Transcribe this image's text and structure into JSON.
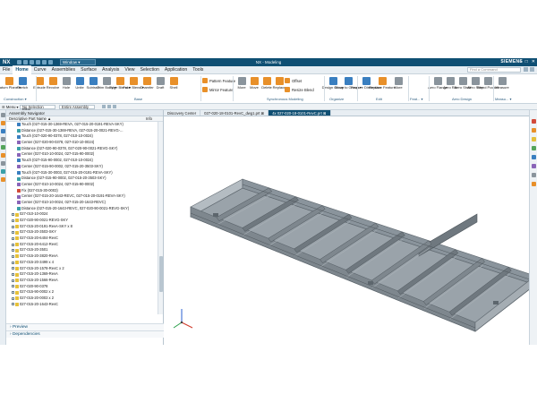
{
  "app": {
    "brand": "NX",
    "window_menu": "Window ▾",
    "window_title": "NX - Modeling",
    "company": "SIEMENS",
    "command_finder_placeholder": "Find a Command"
  },
  "menu": [
    "File",
    "Home",
    "Curve",
    "Assemblies",
    "Surface",
    "Analysis",
    "View",
    "Selection",
    "Application",
    "Tools"
  ],
  "menu_active_index": 1,
  "ribbon": {
    "buttons": [
      {
        "label": "Datum Plane ▾",
        "icon": "datum-plane-icon",
        "color": "c-orange"
      },
      {
        "label": "Sketch",
        "icon": "sketch-icon",
        "color": "c-blue"
      },
      {
        "label": "Extrude",
        "icon": "extrude-icon",
        "color": "c-orange"
      },
      {
        "label": "Revolve",
        "icon": "revolve-icon",
        "color": "c-orange"
      },
      {
        "label": "Hole",
        "icon": "hole-icon",
        "color": "c-gray"
      },
      {
        "label": "Unite",
        "icon": "unite-icon",
        "color": "c-blue"
      },
      {
        "label": "Subtract",
        "icon": "subtract-icon",
        "color": "c-blue"
      },
      {
        "label": "Trim Body ▾",
        "icon": "trim-body-icon",
        "color": "c-gray"
      },
      {
        "label": "Edge Blend ▾",
        "icon": "edge-blend-icon",
        "color": "c-orange"
      },
      {
        "label": "Face Blend ▾",
        "icon": "face-blend-icon",
        "color": "c-orange"
      },
      {
        "label": "Chamfer",
        "icon": "chamfer-icon",
        "color": "c-orange"
      },
      {
        "label": "Draft",
        "icon": "draft-icon",
        "color": "c-gray"
      },
      {
        "label": "Shell",
        "icon": "shell-icon",
        "color": "c-orange"
      }
    ],
    "small_buttons": [
      {
        "label": "Pattern Feature",
        "icon": "pattern-feature-icon",
        "color": "c-orange"
      },
      {
        "label": "Mirror Feature",
        "icon": "mirror-feature-icon",
        "color": "c-orange"
      }
    ],
    "sync_buttons": [
      {
        "label": "More",
        "icon": "more-icon",
        "color": "c-gray"
      },
      {
        "label": "Move",
        "icon": "move-face-icon",
        "color": "c-orange"
      },
      {
        "label": "Delete",
        "icon": "delete-face-icon",
        "color": "c-orange"
      },
      {
        "label": "Replace",
        "icon": "replace-face-icon",
        "color": "c-orange"
      }
    ],
    "sync_small": [
      {
        "label": "Offset",
        "icon": "offset-icon",
        "color": "c-orange"
      },
      {
        "label": "Resize Blend",
        "icon": "resize-blend-icon",
        "color": "c-orange"
      }
    ],
    "organize_buttons": [
      {
        "label": "Design Group",
        "icon": "design-group-icon",
        "color": "c-blue"
      },
      {
        "label": "Move to Group ▾",
        "icon": "move-to-group-icon",
        "color": "c-blue"
      }
    ],
    "edit_buttons": [
      {
        "label": "Feature Dimension",
        "icon": "feature-dimension-icon",
        "color": "c-blue"
      },
      {
        "label": "Replace Feature",
        "icon": "replace-feature-icon",
        "color": "c-orange"
      },
      {
        "label": "More",
        "icon": "more-edit-icon",
        "color": "c-gray"
      }
    ],
    "aero_buttons": [
      {
        "label": "Aero Flange",
        "icon": "aero-flange-icon",
        "color": "c-gray"
      },
      {
        "label": "Aero Rib",
        "icon": "aero-rib-icon",
        "color": "c-gray"
      },
      {
        "label": "Aero Shelf",
        "icon": "aero-shelf-icon",
        "color": "c-gray"
      },
      {
        "label": "Aero Step",
        "icon": "aero-step-icon",
        "color": "c-gray"
      },
      {
        "label": "Blend Pocket",
        "icon": "blend-pocket-icon",
        "color": "c-gray"
      }
    ],
    "measure_button": {
      "label": "Measure",
      "icon": "measure-icon",
      "color": "c-gray"
    },
    "groups": [
      "Construction ▾",
      "Base",
      "Synchronous Modeling",
      "Organize",
      "Edit",
      "Feat... ▾",
      "Aero Design",
      "Measu... ▾"
    ]
  },
  "filter": {
    "menu": "☰ Menu ▾",
    "type_filter": "No Selection Filter",
    "scope": "Entire Assembly"
  },
  "navigator": {
    "title": "Assembly Navigator",
    "column_header": "Descriptive Part Name ▲",
    "info_header": "Info",
    "rows": [
      {
        "text": "Touch (027-015-30-1369-REVA, 027-015-20-0191-REVA-SKY)",
        "icon": "constraint-touch-icon",
        "kind": "sub"
      },
      {
        "text": "Distance (027-015-30-1369-REVA, 027-015-20-0021-REVG-...",
        "icon": "constraint-distance-icon",
        "kind": "sub"
      },
      {
        "text": "Touch (027-020-90-0378, 027-010-10-0024)",
        "icon": "constraint-touch-icon",
        "kind": "sub"
      },
      {
        "text": "Center (027-020-90-0378, 027-010-10-0024)",
        "icon": "constraint-center-icon",
        "kind": "sub"
      },
      {
        "text": "Distance (027-020-90-0378, 027-020-90-0021-REVG-SKY)",
        "icon": "constraint-distance-icon",
        "kind": "sub"
      },
      {
        "text": "Center (027-010-10-0024, 027-015-90-0002)",
        "icon": "constraint-center-icon",
        "kind": "sub"
      },
      {
        "text": "Touch (027-015-90-0002, 027-010-10-0024)",
        "icon": "constraint-touch-icon",
        "kind": "sub"
      },
      {
        "text": "Center (027-015-90-0002, 027-015-20-3503-SKY)",
        "icon": "constraint-center-icon",
        "kind": "sub"
      },
      {
        "text": "Touch (027-015-30-0003, 027-015-20-0191-REVA-SKY)",
        "icon": "constraint-touch-icon",
        "kind": "sub"
      },
      {
        "text": "Distance (027-015-90-0002, 027-015-20-3503-SKY)",
        "icon": "constraint-distance-icon",
        "kind": "sub"
      },
      {
        "text": "Center (027-010-10-0024, 027-015-90-0002)",
        "icon": "constraint-center-icon",
        "kind": "sub"
      },
      {
        "text": "Fix (027-015-30-0003)",
        "icon": "constraint-fix-icon",
        "kind": "sub"
      },
      {
        "text": "Center (027-015-20-1643-REVC, 027-015-20-0191-REVA-SKY)",
        "icon": "constraint-center-icon",
        "kind": "sub"
      },
      {
        "text": "Center (027-010-10-0024, 027-015-20-1643-REVC)",
        "icon": "constraint-center-icon",
        "kind": "sub"
      },
      {
        "text": "Distance (027-015-20-1643-REVC, 027-020-90-0021-REVG-SKY)",
        "icon": "constraint-distance-icon",
        "kind": "sub"
      },
      {
        "text": "027-010-10-0024",
        "icon": "component-icon",
        "kind": "top"
      },
      {
        "text": "027-020-90-0021-REVG-SKY",
        "icon": "component-icon",
        "kind": "top"
      },
      {
        "text": "027-015-20-0191-RevA-SKY x 8",
        "icon": "component-icon",
        "kind": "top"
      },
      {
        "text": "027-015-20-3503-SKY",
        "icon": "component-icon",
        "kind": "top"
      },
      {
        "text": "027-015-20-6404-RevC",
        "icon": "component-icon",
        "kind": "top"
      },
      {
        "text": "027-015-20-6412-RevC",
        "icon": "component-icon",
        "kind": "top"
      },
      {
        "text": "027-015-20-3501",
        "icon": "component-icon",
        "kind": "top"
      },
      {
        "text": "027-015-20-3820-RevA",
        "icon": "component-icon",
        "kind": "top"
      },
      {
        "text": "027-015-20-3499 x 4",
        "icon": "component-icon",
        "kind": "top"
      },
      {
        "text": "027-015-20-1578-RevC x 2",
        "icon": "component-icon",
        "kind": "top"
      },
      {
        "text": "027-015-20-1369-RevA",
        "icon": "component-icon",
        "kind": "top"
      },
      {
        "text": "027-015-20-1566-RevA",
        "icon": "component-icon",
        "kind": "top"
      },
      {
        "text": "027-020-90-0378",
        "icon": "component-icon",
        "kind": "top"
      },
      {
        "text": "027-015-90-0002 x 2",
        "icon": "component-icon",
        "kind": "top"
      },
      {
        "text": "027-015-20-0003 x 2",
        "icon": "component-icon",
        "kind": "top"
      },
      {
        "text": "027-015-20-1643-RevC",
        "icon": "component-icon",
        "kind": "top"
      }
    ],
    "footer": [
      "Preview",
      "Dependencies"
    ]
  },
  "tabs": [
    {
      "label": "Discovery Center",
      "active": false
    },
    {
      "label": "027-020-18-0101-RevC_dwg1.prt ⊠",
      "active": false
    },
    {
      "label": "4x 027-020-18-0101-RevC.prt ⊠",
      "active": true
    }
  ],
  "graphics": {
    "model": "sheet-metal-frame-assembly",
    "triad": "wcs-triad-icon"
  },
  "colors": {
    "titlebar": "#0f4f73",
    "accent": "#e8902a",
    "model_gray": "#8a949c"
  }
}
